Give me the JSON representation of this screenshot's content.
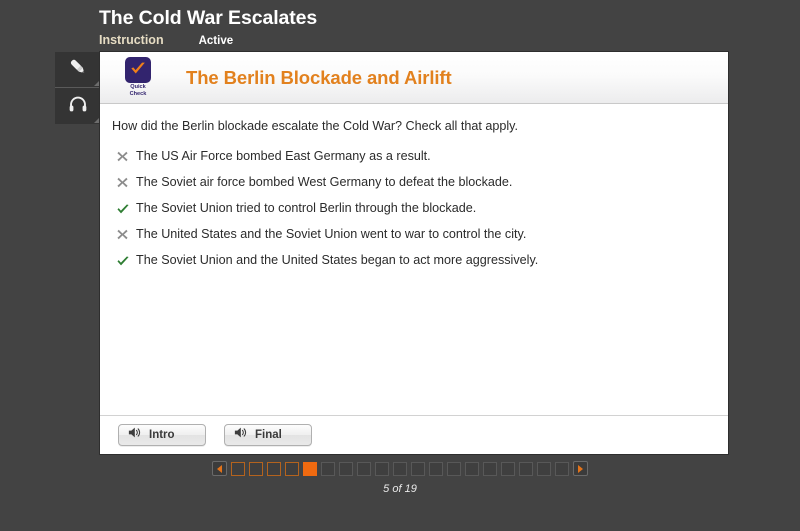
{
  "header": {
    "course_title": "The Cold War Escalates",
    "tab_instruction": "Instruction",
    "tab_active": "Active"
  },
  "toolbar": {
    "items": [
      {
        "icon": "pencil-icon",
        "name": "highlighter-tool"
      },
      {
        "icon": "headphones-icon",
        "name": "audio-tool"
      }
    ]
  },
  "card": {
    "badge": {
      "line1": "Quick",
      "line2": "Check",
      "icon": "orange-checkmark-icon"
    },
    "title": "The Berlin Blockade and Airlift",
    "question": "How did the Berlin blockade escalate the Cold War? Check all that apply.",
    "options": [
      {
        "mark": "cross",
        "text": "The US Air Force bombed East Germany as a result."
      },
      {
        "mark": "cross",
        "text": "The Soviet air force bombed West Germany to defeat the blockade."
      },
      {
        "mark": "check",
        "text": "The Soviet Union tried to control Berlin through the blockade."
      },
      {
        "mark": "cross",
        "text": "The United States and the Soviet Union went to war to control the city."
      },
      {
        "mark": "check",
        "text": "The Soviet Union and the United States began to act more aggressively."
      }
    ],
    "footer_buttons": [
      {
        "label": "Intro",
        "icon": "speaker-icon"
      },
      {
        "label": "Final",
        "icon": "speaker-icon"
      }
    ]
  },
  "pager": {
    "prev_label": "◀",
    "next_label": "▶",
    "total": 19,
    "current": 5,
    "visited": 5,
    "status": "5 of 19"
  },
  "colors": {
    "background": "#434343",
    "accent_orange": "#e2811e",
    "current_page": "#f06a10",
    "check_green": "#2e7d32",
    "cross_gray": "#8c8c8c",
    "badge_navy": "#32246e",
    "tab_cream": "#e6dcc3"
  }
}
